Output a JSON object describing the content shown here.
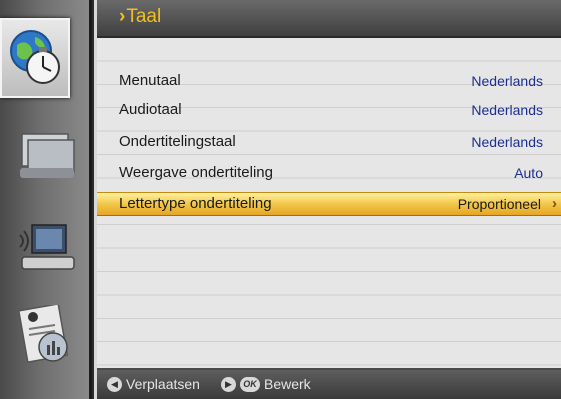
{
  "header": {
    "chevron": "›",
    "title": "Taal"
  },
  "sidebar": {
    "items": [
      {
        "icon": "globe-clock-icon",
        "active": true
      },
      {
        "icon": "folders-icon",
        "active": false
      },
      {
        "icon": "computer-network-icon",
        "active": false
      },
      {
        "icon": "system-report-icon",
        "active": false
      }
    ]
  },
  "rows": [
    {
      "label": "Menutaal",
      "value": "Nederlands"
    },
    {
      "label": "Audiotaal",
      "value": "Nederlands"
    },
    {
      "label": "Ondertitelingstaal",
      "value": "Nederlands"
    },
    {
      "label": "Weergave ondertiteling",
      "value": "Auto"
    },
    {
      "label": "Lettertype ondertiteling",
      "value": "Proportioneel",
      "selected": true
    }
  ],
  "footer": {
    "move_icon": "◀",
    "move_label": "Verplaatsen",
    "edit_icon": "▶",
    "ok_label": "OK",
    "edit_label": "Bewerk"
  },
  "colors": {
    "accent": "#f0c020",
    "value_text": "#1a2f8f",
    "selection": "#f2c64a"
  }
}
